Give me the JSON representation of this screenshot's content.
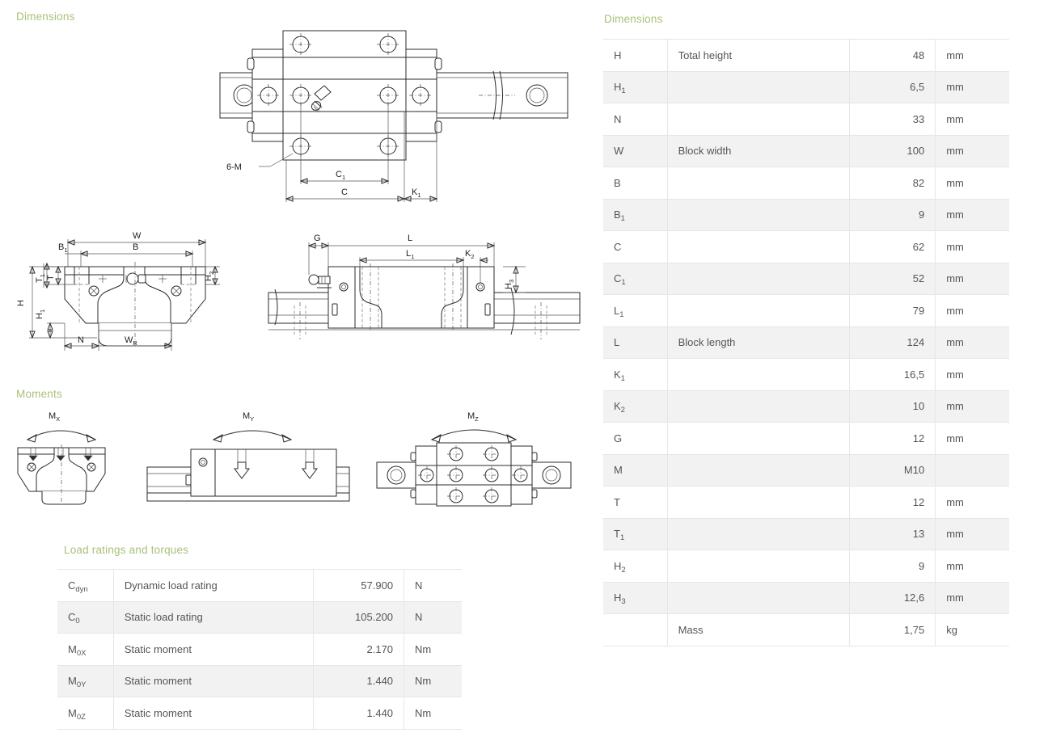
{
  "sections": {
    "dimensions_left": "Dimensions",
    "moments": "Moments",
    "load_ratings": "Load ratings and torques",
    "dimensions_right": "Dimensions"
  },
  "colors": {
    "heading": "#a9c178",
    "row_alt": "#f2f2f2",
    "border": "#e6e6e6",
    "text": "#555555",
    "line": "#2b2b2b"
  },
  "dimensions_table": {
    "rows": [
      {
        "symbol": "H",
        "sub": "",
        "desc": "Total height",
        "value": "48",
        "unit": "mm"
      },
      {
        "symbol": "H",
        "sub": "1",
        "desc": "",
        "value": "6,5",
        "unit": "mm"
      },
      {
        "symbol": "N",
        "sub": "",
        "desc": "",
        "value": "33",
        "unit": "mm"
      },
      {
        "symbol": "W",
        "sub": "",
        "desc": "Block width",
        "value": "100",
        "unit": "mm"
      },
      {
        "symbol": "B",
        "sub": "",
        "desc": "",
        "value": "82",
        "unit": "mm"
      },
      {
        "symbol": "B",
        "sub": "1",
        "desc": "",
        "value": "9",
        "unit": "mm"
      },
      {
        "symbol": "C",
        "sub": "",
        "desc": "",
        "value": "62",
        "unit": "mm"
      },
      {
        "symbol": "C",
        "sub": "1",
        "desc": "",
        "value": "52",
        "unit": "mm"
      },
      {
        "symbol": "L",
        "sub": "1",
        "desc": "",
        "value": "79",
        "unit": "mm"
      },
      {
        "symbol": "L",
        "sub": "",
        "desc": "Block length",
        "value": "124",
        "unit": "mm"
      },
      {
        "symbol": "K",
        "sub": "1",
        "desc": "",
        "value": "16,5",
        "unit": "mm"
      },
      {
        "symbol": "K",
        "sub": "2",
        "desc": "",
        "value": "10",
        "unit": "mm"
      },
      {
        "symbol": "G",
        "sub": "",
        "desc": "",
        "value": "12",
        "unit": "mm"
      },
      {
        "symbol": "M",
        "sub": "",
        "desc": "",
        "value": "M10",
        "unit": ""
      },
      {
        "symbol": "T",
        "sub": "",
        "desc": "",
        "value": "12",
        "unit": "mm"
      },
      {
        "symbol": "T",
        "sub": "1",
        "desc": "",
        "value": "13",
        "unit": "mm"
      },
      {
        "symbol": "H",
        "sub": "2",
        "desc": "",
        "value": "9",
        "unit": "mm"
      },
      {
        "symbol": "H",
        "sub": "3",
        "desc": "",
        "value": "12,6",
        "unit": "mm"
      },
      {
        "symbol": "",
        "sub": "",
        "desc": "Mass",
        "value": "1,75",
        "unit": "kg"
      }
    ]
  },
  "load_table": {
    "rows": [
      {
        "symbol": "C",
        "sub": "dyn",
        "desc": "Dynamic load rating",
        "value": "57.900",
        "unit": "N"
      },
      {
        "symbol": "C",
        "sub": "0",
        "desc": "Static load rating",
        "value": "105.200",
        "unit": "N"
      },
      {
        "symbol": "M",
        "sub": "0X",
        "desc": "Static moment",
        "value": "2.170",
        "unit": "Nm"
      },
      {
        "symbol": "M",
        "sub": "0Y",
        "desc": "Static moment",
        "value": "1.440",
        "unit": "Nm"
      },
      {
        "symbol": "M",
        "sub": "0Z",
        "desc": "Static moment",
        "value": "1.440",
        "unit": "Nm"
      }
    ]
  },
  "drawings": {
    "top_view": {
      "name": "top-view-carriage-on-rail",
      "labels": [
        "6-M",
        "C1",
        "C",
        "K1"
      ]
    },
    "front_view": {
      "name": "front-view-cross-section",
      "labels": [
        "W",
        "B",
        "B1",
        "T1",
        "T",
        "H2",
        "H",
        "H1",
        "N",
        "WR"
      ]
    },
    "side_view": {
      "name": "side-view-carriage-on-rail",
      "labels": [
        "G",
        "L",
        "L1",
        "K2",
        "H3"
      ]
    },
    "moment_mx": {
      "name": "moment-mx-diagram",
      "label": "Mx",
      "axis": "X"
    },
    "moment_my": {
      "name": "moment-my-diagram",
      "label": "My",
      "axis": "Y"
    },
    "moment_mz": {
      "name": "moment-mz-diagram",
      "label": "Mz",
      "axis": "Z"
    }
  }
}
